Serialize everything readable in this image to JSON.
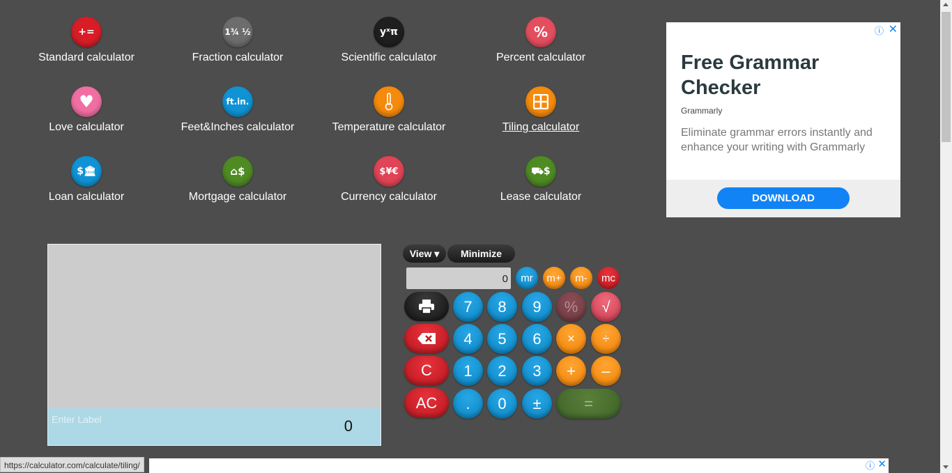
{
  "menu": [
    {
      "label": "Standard calculator",
      "icon": "plus-equals-icon",
      "glyph": "+=×",
      "color": "#d81d27"
    },
    {
      "label": "Fraction calculator",
      "icon": "fraction-icon",
      "glyph": "1¾ ½",
      "color": "#6d6d6d"
    },
    {
      "label": "Scientific calculator",
      "icon": "scientific-icon",
      "glyph": "yˣπ",
      "color": "#1f1f1f"
    },
    {
      "label": "Percent calculator",
      "icon": "percent-icon",
      "glyph": "%",
      "color": "#e34e5f"
    },
    {
      "label": "Love calculator",
      "icon": "heart-icon",
      "glyph": "♥",
      "color": "#f06fa3"
    },
    {
      "label": "Feet&Inches calculator",
      "icon": "ruler-icon",
      "glyph": "ft.in.",
      "color": "#0f93d4"
    },
    {
      "label": "Temperature calculator",
      "icon": "thermometer-icon",
      "glyph": "🌡",
      "color": "#f58a0c"
    },
    {
      "label": "Tiling calculator",
      "icon": "tiles-icon",
      "glyph": "▦",
      "color": "#f58a0c"
    },
    {
      "label": "Loan calculator",
      "icon": "bank-icon",
      "glyph": "$%",
      "color": "#0f93d4"
    },
    {
      "label": "Mortgage calculator",
      "icon": "house-icon",
      "glyph": "⌂$",
      "color": "#4e8b23"
    },
    {
      "label": "Currency calculator",
      "icon": "currency-icon",
      "glyph": "$¥€",
      "color": "#e04456"
    },
    {
      "label": "Lease calculator",
      "icon": "car-icon",
      "glyph": "⛟$",
      "color": "#4e8b23"
    }
  ],
  "ad": {
    "title": "Free Grammar Checker",
    "brand": "Grammarly",
    "description": "Eliminate grammar errors instantly and enhance your writing with Grammarly",
    "button": "DOWNLOAD",
    "info": "ⓘ",
    "close": "✕"
  },
  "tape": {
    "label_placeholder": "Enter Label",
    "value": "0"
  },
  "calc": {
    "view_label": "View ▾",
    "minimize_label": "Minimize",
    "display": "0",
    "memory": [
      "mr",
      "m+",
      "m-",
      "mc"
    ],
    "keys": {
      "print": "🖶",
      "backspace": "⌫",
      "clear": "C",
      "all_clear": "AC",
      "n7": "7",
      "n8": "8",
      "n9": "9",
      "n4": "4",
      "n5": "5",
      "n6": "6",
      "n1": "1",
      "n2": "2",
      "n3": "3",
      "dot": ".",
      "n0": "0",
      "plusminus": "±",
      "percent": "%",
      "sqrt": "√",
      "multiply": "×",
      "divide": "÷",
      "plus": "+",
      "minus": "–",
      "equals": "="
    }
  },
  "status_url": "https://calculator.com/calculate/tiling/",
  "bottom_ad": {
    "info": "ⓘ",
    "close": "✕"
  }
}
